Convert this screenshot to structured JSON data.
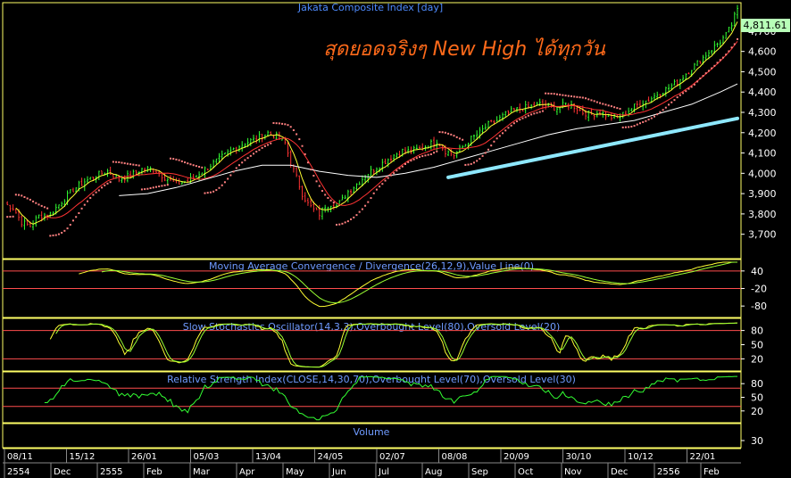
{
  "chart_data": {
    "type": "line",
    "title": "Jakata Composite Index [day]",
    "annotation": "สุดยอดจริงๆ New High ได้ทุกวัน",
    "last_price_label": "4,811.61",
    "colors": {
      "background": "#000000",
      "title": "#4f8cff",
      "panel_title": "#6f9bff",
      "axis_text": "#ffffff",
      "panel_border": "#ffff66",
      "level_line": "#ff4d4d",
      "candle_up": "#33ff33",
      "candle_down": "#ff3333",
      "sar": "#ff8080",
      "ma_fast": "#ffff33",
      "ma_mid": "#ff3333",
      "ma_slow": "#ffffff",
      "trendline": "#8ee8ff",
      "annotation": "#ff6a1a",
      "osc_main": "#ffff33",
      "osc_signal": "#99ff33",
      "rsi": "#33ff33",
      "price_label_bg": "#b8ffb8"
    },
    "price_panel": {
      "ylim": [
        3580,
        4840
      ],
      "yticks": [
        3700,
        3800,
        3900,
        4000,
        4100,
        4200,
        4300,
        4400,
        4500,
        4600,
        4700
      ],
      "ytick_labels": [
        "3,700",
        "3,800",
        "3,900",
        "4,000",
        "4,100",
        "4,200",
        "4,300",
        "4,400",
        "4,500",
        "4,600",
        "4,700"
      ],
      "close_series": [
        [
          0,
          3850
        ],
        [
          3,
          3830
        ],
        [
          6,
          3760
        ],
        [
          9,
          3740
        ],
        [
          12,
          3790
        ],
        [
          16,
          3800
        ],
        [
          20,
          3860
        ],
        [
          24,
          3920
        ],
        [
          28,
          3960
        ],
        [
          32,
          3990
        ],
        [
          36,
          4010
        ],
        [
          40,
          3970
        ],
        [
          44,
          3990
        ],
        [
          48,
          4020
        ],
        [
          52,
          4020
        ],
        [
          56,
          3980
        ],
        [
          60,
          3950
        ],
        [
          64,
          3960
        ],
        [
          68,
          4000
        ],
        [
          72,
          4040
        ],
        [
          76,
          4080
        ],
        [
          80,
          4120
        ],
        [
          84,
          4150
        ],
        [
          88,
          4170
        ],
        [
          92,
          4200
        ],
        [
          95,
          4180
        ],
        [
          98,
          4150
        ],
        [
          100,
          4050
        ],
        [
          102,
          3980
        ],
        [
          104,
          3900
        ],
        [
          106,
          3850
        ],
        [
          108,
          3820
        ],
        [
          110,
          3800
        ],
        [
          112,
          3840
        ],
        [
          114,
          3850
        ],
        [
          116,
          3840
        ],
        [
          118,
          3870
        ],
        [
          120,
          3910
        ],
        [
          124,
          3960
        ],
        [
          127,
          4000
        ],
        [
          130,
          4030
        ],
        [
          133,
          4060
        ],
        [
          136,
          4090
        ],
        [
          139,
          4110
        ],
        [
          142,
          4110
        ],
        [
          145,
          4120
        ],
        [
          148,
          4140
        ],
        [
          151,
          4160
        ],
        [
          154,
          4110
        ],
        [
          157,
          4090
        ],
        [
          160,
          4130
        ],
        [
          163,
          4170
        ],
        [
          166,
          4200
        ],
        [
          169,
          4240
        ],
        [
          172,
          4260
        ],
        [
          175,
          4290
        ],
        [
          178,
          4310
        ],
        [
          181,
          4320
        ],
        [
          184,
          4330
        ],
        [
          187,
          4340
        ],
        [
          190,
          4330
        ],
        [
          193,
          4320
        ],
        [
          196,
          4340
        ],
        [
          199,
          4330
        ],
        [
          202,
          4300
        ],
        [
          205,
          4290
        ],
        [
          208,
          4300
        ],
        [
          211,
          4280
        ],
        [
          214,
          4270
        ],
        [
          217,
          4300
        ],
        [
          220,
          4330
        ],
        [
          223,
          4350
        ],
        [
          226,
          4370
        ],
        [
          229,
          4400
        ],
        [
          232,
          4420
        ],
        [
          235,
          4450
        ],
        [
          238,
          4490
        ],
        [
          241,
          4530
        ],
        [
          244,
          4570
        ],
        [
          247,
          4610
        ],
        [
          250,
          4650
        ],
        [
          252,
          4680
        ],
        [
          254,
          4730
        ],
        [
          256,
          4811.61
        ]
      ],
      "sma_long": [
        [
          40,
          3890
        ],
        [
          50,
          3900
        ],
        [
          60,
          3930
        ],
        [
          70,
          3970
        ],
        [
          80,
          4010
        ],
        [
          90,
          4040
        ],
        [
          100,
          4040
        ],
        [
          110,
          4010
        ],
        [
          120,
          3990
        ],
        [
          130,
          3980
        ],
        [
          140,
          4000
        ],
        [
          150,
          4030
        ],
        [
          160,
          4070
        ],
        [
          170,
          4110
        ],
        [
          180,
          4150
        ],
        [
          190,
          4190
        ],
        [
          200,
          4220
        ],
        [
          210,
          4240
        ],
        [
          220,
          4260
        ],
        [
          230,
          4300
        ],
        [
          240,
          4340
        ],
        [
          250,
          4400
        ],
        [
          256,
          4440
        ]
      ],
      "trendline": [
        [
          155,
          3980
        ],
        [
          256,
          4270
        ]
      ],
      "x_max": 256
    },
    "macd_panel": {
      "title": "Moving Average Convergence / Divergence(26,12,9),Value Line(0)",
      "ylim": [
        -110,
        70
      ],
      "yticks": [
        40,
        -20,
        -80
      ],
      "level_lines": [
        40,
        -20
      ]
    },
    "stochastic_panel": {
      "title": "Slow Stochastics Oscillator(14,3,3),Overbought Level(80),Oversold Level(20)",
      "ylim": [
        0,
        100
      ],
      "yticks": [
        80,
        50,
        20
      ],
      "level_lines": [
        80,
        20
      ]
    },
    "rsi_panel": {
      "title": "Relative Strength Index(CLOSE,14,30,70),Overbought Level(70),Oversold Level(30)",
      "ylim": [
        0,
        100
      ],
      "yticks": [
        80,
        50,
        20
      ],
      "level_lines": [
        70,
        30
      ]
    },
    "volume_panel": {
      "title": "Volume",
      "yticks": [
        30
      ],
      "ytick_labels": [
        "30"
      ]
    },
    "x_axis": {
      "date_ticks": [
        "08/11",
        "15/12",
        "26/01",
        "05/03",
        "13/04",
        "24/05",
        "02/07",
        "08/08",
        "20/09",
        "30/10",
        "10/12",
        "22/01"
      ],
      "month_labels": [
        "2554",
        "Dec",
        "2555",
        "Feb",
        "Mar",
        "Apr",
        "May",
        "Jun",
        "Jul",
        "Aug",
        "Sep",
        "Oct",
        "Nov",
        "Dec",
        "2556",
        "Feb"
      ]
    }
  }
}
